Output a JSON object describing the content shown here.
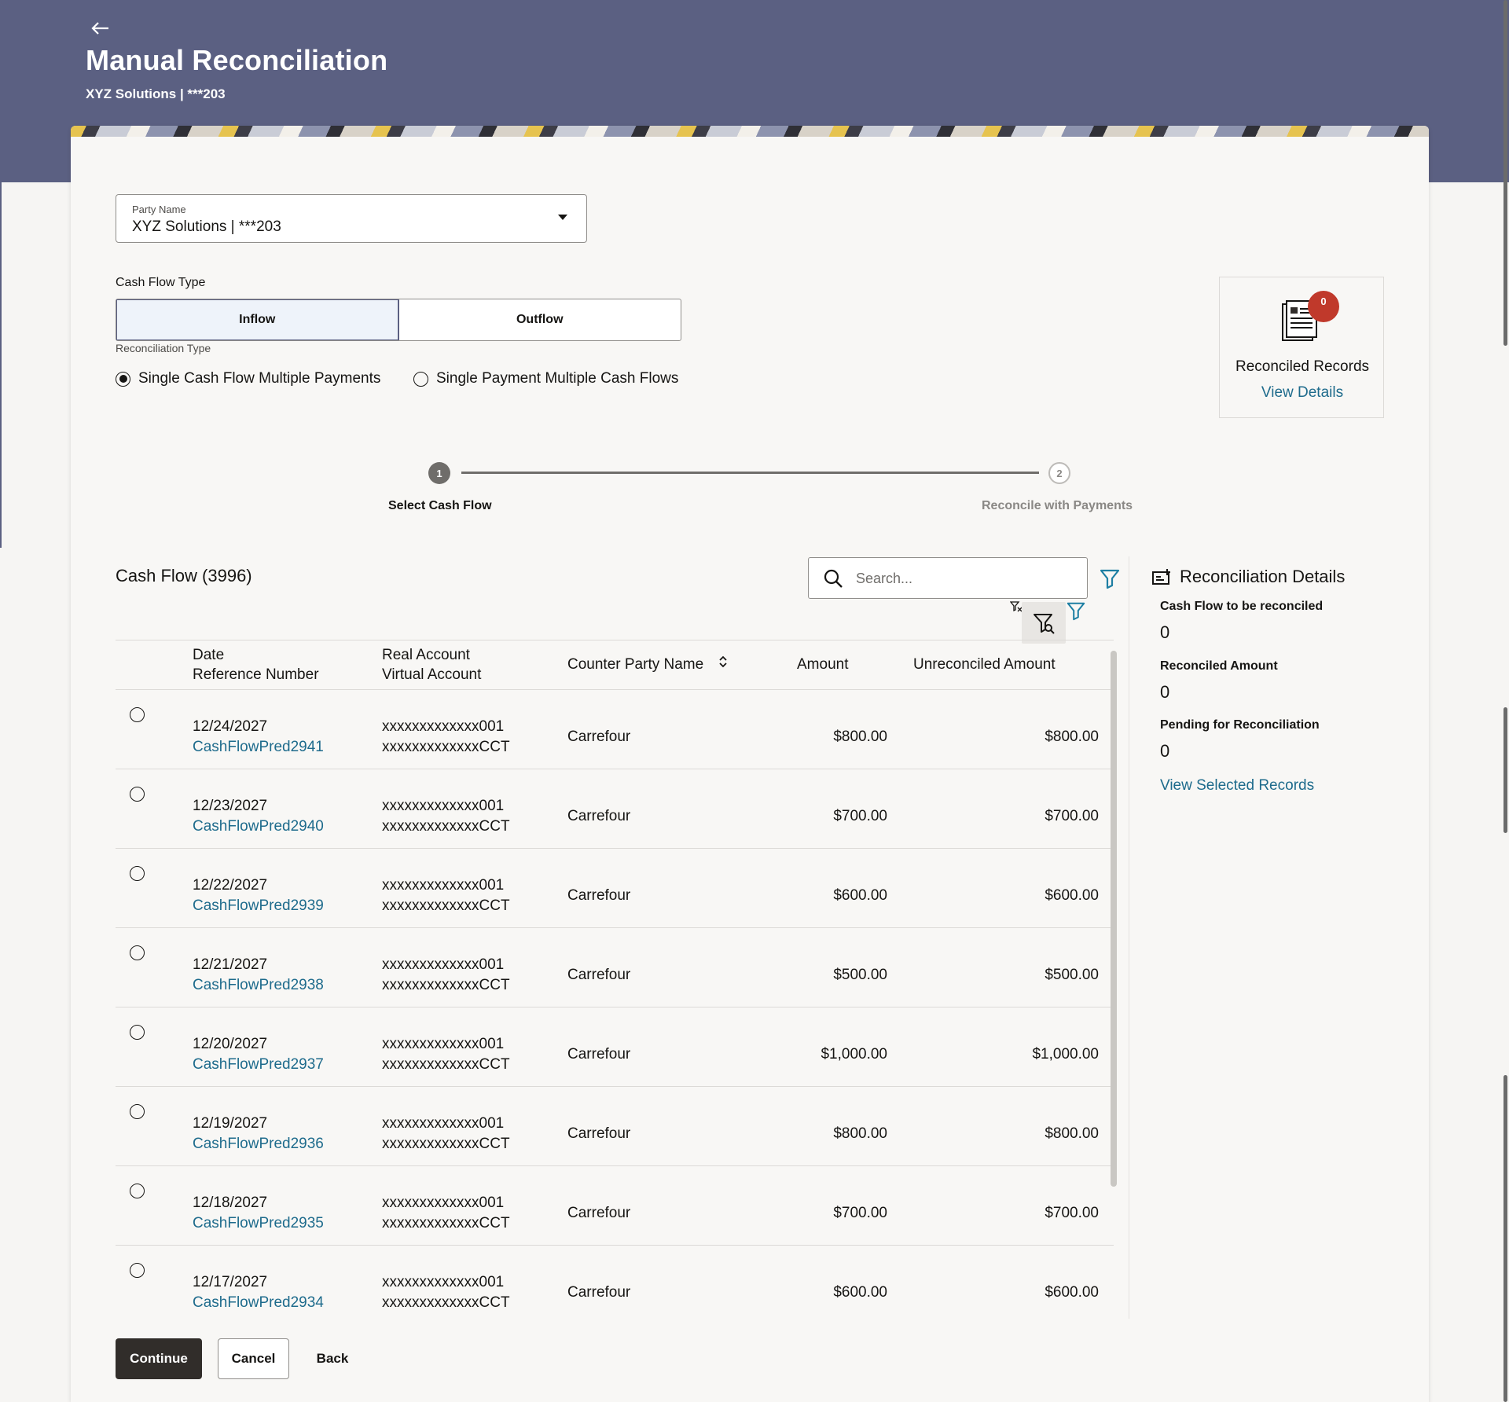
{
  "header": {
    "title": "Manual Reconciliation",
    "subtitle": "XYZ Solutions | ***203"
  },
  "party": {
    "label": "Party Name",
    "value": "XYZ Solutions | ***203"
  },
  "cash_flow_type": {
    "label": "Cash Flow Type",
    "options": [
      "Inflow",
      "Outflow"
    ],
    "selected": "Inflow"
  },
  "reconciliation_type": {
    "label": "Reconciliation Type",
    "options": [
      "Single Cash Flow Multiple Payments",
      "Single Payment Multiple Cash Flows"
    ],
    "selected": "Single Cash Flow Multiple Payments"
  },
  "reconciled_records": {
    "badge": "0",
    "title": "Reconciled Records",
    "link": "View Details",
    "badge_color": "#c0392b"
  },
  "steps": [
    {
      "number": "1",
      "label": "Select Cash Flow"
    },
    {
      "number": "2",
      "label": "Reconcile with Payments"
    }
  ],
  "cash_flow": {
    "title": "Cash Flow (3996)",
    "search_placeholder": "Search..."
  },
  "table": {
    "headers": {
      "date": "Date",
      "reference": "Reference Number",
      "real_account": "Real Account",
      "virtual_account": "Virtual Account",
      "counter_party": "Counter Party Name",
      "amount": "Amount",
      "unreconciled": "Unreconciled Amount"
    },
    "rows": [
      {
        "date": "12/24/2027",
        "reference": "CashFlowPred2941",
        "real_account": "xxxxxxxxxxxxx001",
        "virtual_account": "xxxxxxxxxxxxxCCT",
        "counter_party": "Carrefour",
        "amount": "$800.00",
        "unreconciled": "$800.00"
      },
      {
        "date": "12/23/2027",
        "reference": "CashFlowPred2940",
        "real_account": "xxxxxxxxxxxxx001",
        "virtual_account": "xxxxxxxxxxxxxCCT",
        "counter_party": "Carrefour",
        "amount": "$700.00",
        "unreconciled": "$700.00"
      },
      {
        "date": "12/22/2027",
        "reference": "CashFlowPred2939",
        "real_account": "xxxxxxxxxxxxx001",
        "virtual_account": "xxxxxxxxxxxxxCCT",
        "counter_party": "Carrefour",
        "amount": "$600.00",
        "unreconciled": "$600.00"
      },
      {
        "date": "12/21/2027",
        "reference": "CashFlowPred2938",
        "real_account": "xxxxxxxxxxxxx001",
        "virtual_account": "xxxxxxxxxxxxxCCT",
        "counter_party": "Carrefour",
        "amount": "$500.00",
        "unreconciled": "$500.00"
      },
      {
        "date": "12/20/2027",
        "reference": "CashFlowPred2937",
        "real_account": "xxxxxxxxxxxxx001",
        "virtual_account": "xxxxxxxxxxxxxCCT",
        "counter_party": "Carrefour",
        "amount": "$1,000.00",
        "unreconciled": "$1,000.00"
      },
      {
        "date": "12/19/2027",
        "reference": "CashFlowPred2936",
        "real_account": "xxxxxxxxxxxxx001",
        "virtual_account": "xxxxxxxxxxxxxCCT",
        "counter_party": "Carrefour",
        "amount": "$800.00",
        "unreconciled": "$800.00"
      },
      {
        "date": "12/18/2027",
        "reference": "CashFlowPred2935",
        "real_account": "xxxxxxxxxxxxx001",
        "virtual_account": "xxxxxxxxxxxxxCCT",
        "counter_party": "Carrefour",
        "amount": "$700.00",
        "unreconciled": "$700.00"
      },
      {
        "date": "12/17/2027",
        "reference": "CashFlowPred2934",
        "real_account": "xxxxxxxxxxxxx001",
        "virtual_account": "xxxxxxxxxxxxxCCT",
        "counter_party": "Carrefour",
        "amount": "$600.00",
        "unreconciled": "$600.00"
      }
    ]
  },
  "reconciliation_details": {
    "title": "Reconciliation Details",
    "items": [
      {
        "label": "Cash Flow to be reconciled",
        "value": "0"
      },
      {
        "label": "Reconciled Amount",
        "value": "0"
      },
      {
        "label": "Pending for Reconciliation",
        "value": "0"
      }
    ],
    "link": "View Selected Records"
  },
  "actions": {
    "continue": "Continue",
    "cancel": "Cancel",
    "back": "Back"
  },
  "icons": {
    "back": "back-arrow-icon",
    "search": "search-icon",
    "filter": "filter-icon",
    "clear_filter": "clear-filter-icon",
    "advanced_filter": "advanced-filter-icon",
    "sort": "sort-icon",
    "details": "reconciliation-details-icon",
    "records": "document-icon"
  },
  "colors": {
    "header_bg": "#5b6082",
    "link": "#1e6b8c",
    "primary_button": "#312d2a",
    "filter_accent": "#1e7fa3"
  }
}
